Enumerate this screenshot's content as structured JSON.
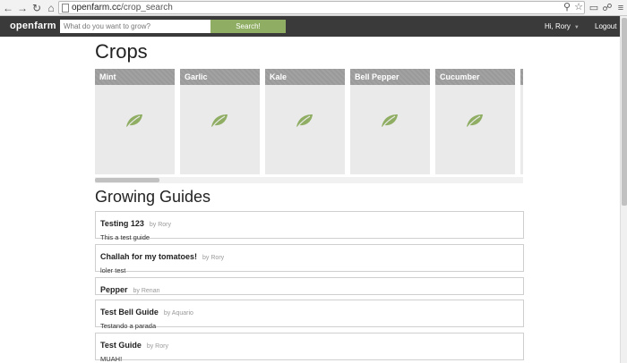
{
  "browser": {
    "url_domain": "openfarm.cc",
    "url_path": "/crop_search"
  },
  "topbar": {
    "logo": "openfarm",
    "search_placeholder": "What do you want to grow?",
    "search_button": "Search!",
    "user_menu": "Hi, Rory",
    "logout": "Logout"
  },
  "crops": {
    "heading": "Crops",
    "items": [
      {
        "name": "Mint"
      },
      {
        "name": "Garlic"
      },
      {
        "name": "Kale"
      },
      {
        "name": "Bell Pepper"
      },
      {
        "name": "Cucumber"
      }
    ],
    "leaf_color": "#8fae63"
  },
  "guides": {
    "heading": "Growing Guides",
    "items": [
      {
        "title": "Testing 123",
        "author": "by Rory",
        "description": "This a test guide"
      },
      {
        "title": "Challah for my tomatoes!",
        "author": "by Rory",
        "description": "loler test"
      },
      {
        "title": "Pepper",
        "author": "by Renan",
        "description": ""
      },
      {
        "title": "Test Bell Guide",
        "author": "by Aquario",
        "description": "Testando a parada"
      },
      {
        "title": "Test Guide",
        "author": "by Rory",
        "description": "MUAH!"
      }
    ]
  }
}
